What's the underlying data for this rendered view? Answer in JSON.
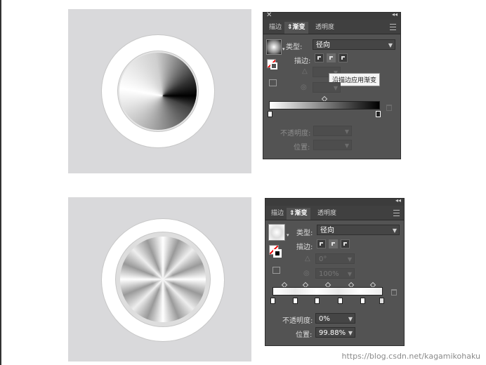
{
  "panel_top": {
    "tabs": [
      "描边",
      "渐变",
      "透明度"
    ],
    "active_tab": 1,
    "type_label": "类型:",
    "type_value": "径向",
    "stroke_label": "描边:",
    "tooltip": "沿描边应用渐变",
    "opacity_label": "不透明度:",
    "position_label": "位置:",
    "opacity_value": "",
    "position_value": ""
  },
  "panel_bottom": {
    "tabs": [
      "描边",
      "渐变",
      "透明度"
    ],
    "active_tab": 1,
    "type_label": "类型:",
    "type_value": "径向",
    "stroke_label": "描边:",
    "angle_value": "0°",
    "ratio_value": "100%",
    "opacity_label": "不透明度:",
    "opacity_value": "0%",
    "position_label": "位置:",
    "position_value": "99.88%"
  },
  "watermark": "https://blog.csdn.net/kagamikohaku",
  "colors": {
    "panel_bg": "#535353",
    "preview_bg": "#d9d9db",
    "tab_bar": "#404040"
  }
}
